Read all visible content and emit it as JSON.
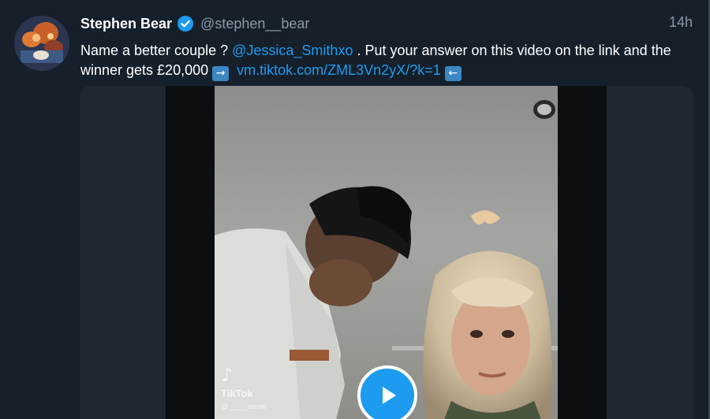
{
  "tweet": {
    "display_name": "Stephen Bear",
    "handle": "@stephen__bear",
    "time": "14h",
    "text_part1": "Name a better couple ? ",
    "mention": "@Jessica_Smithxo",
    "text_part2": " . Put your answer on this video on the link and the winner gets £20,000 ",
    "emoji_right": "→",
    "link": "vm.tiktok.com/ZML3Vn2yX/?k=1",
    "emoji_left": "←"
  },
  "video": {
    "watermark_logo": "♪",
    "watermark_label": "TikTok",
    "watermark_user": "@_____stevie"
  },
  "colors": {
    "background": "#15202b",
    "accent": "#1d9bf0",
    "secondary_text": "#8b98a5"
  }
}
